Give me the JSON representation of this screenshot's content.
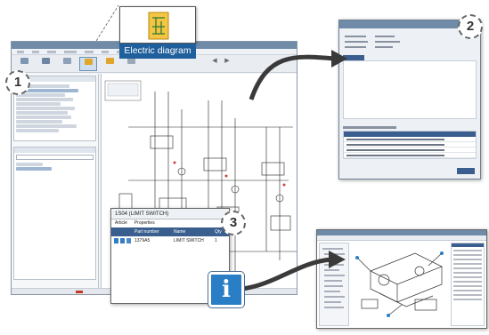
{
  "callouts": {
    "electric_label": "Electric diagram",
    "badge1": "1",
    "badge2": "2",
    "badge3": "3",
    "info_glyph": "i"
  },
  "article_popup": {
    "title": "1S04 (LIMIT SWITCH)",
    "menu": [
      "Article",
      "Properties"
    ],
    "columns": [
      "Part number",
      "Name",
      "Qty"
    ],
    "row": {
      "part_number": "1379A5",
      "name": "LIMIT SWITCH",
      "qty": "1"
    }
  },
  "colors": {
    "accent": "#1f5f9c",
    "table_header": "#3a5f8f",
    "info_blue": "#2a7ec6",
    "arrow": "#3a3a3a"
  }
}
